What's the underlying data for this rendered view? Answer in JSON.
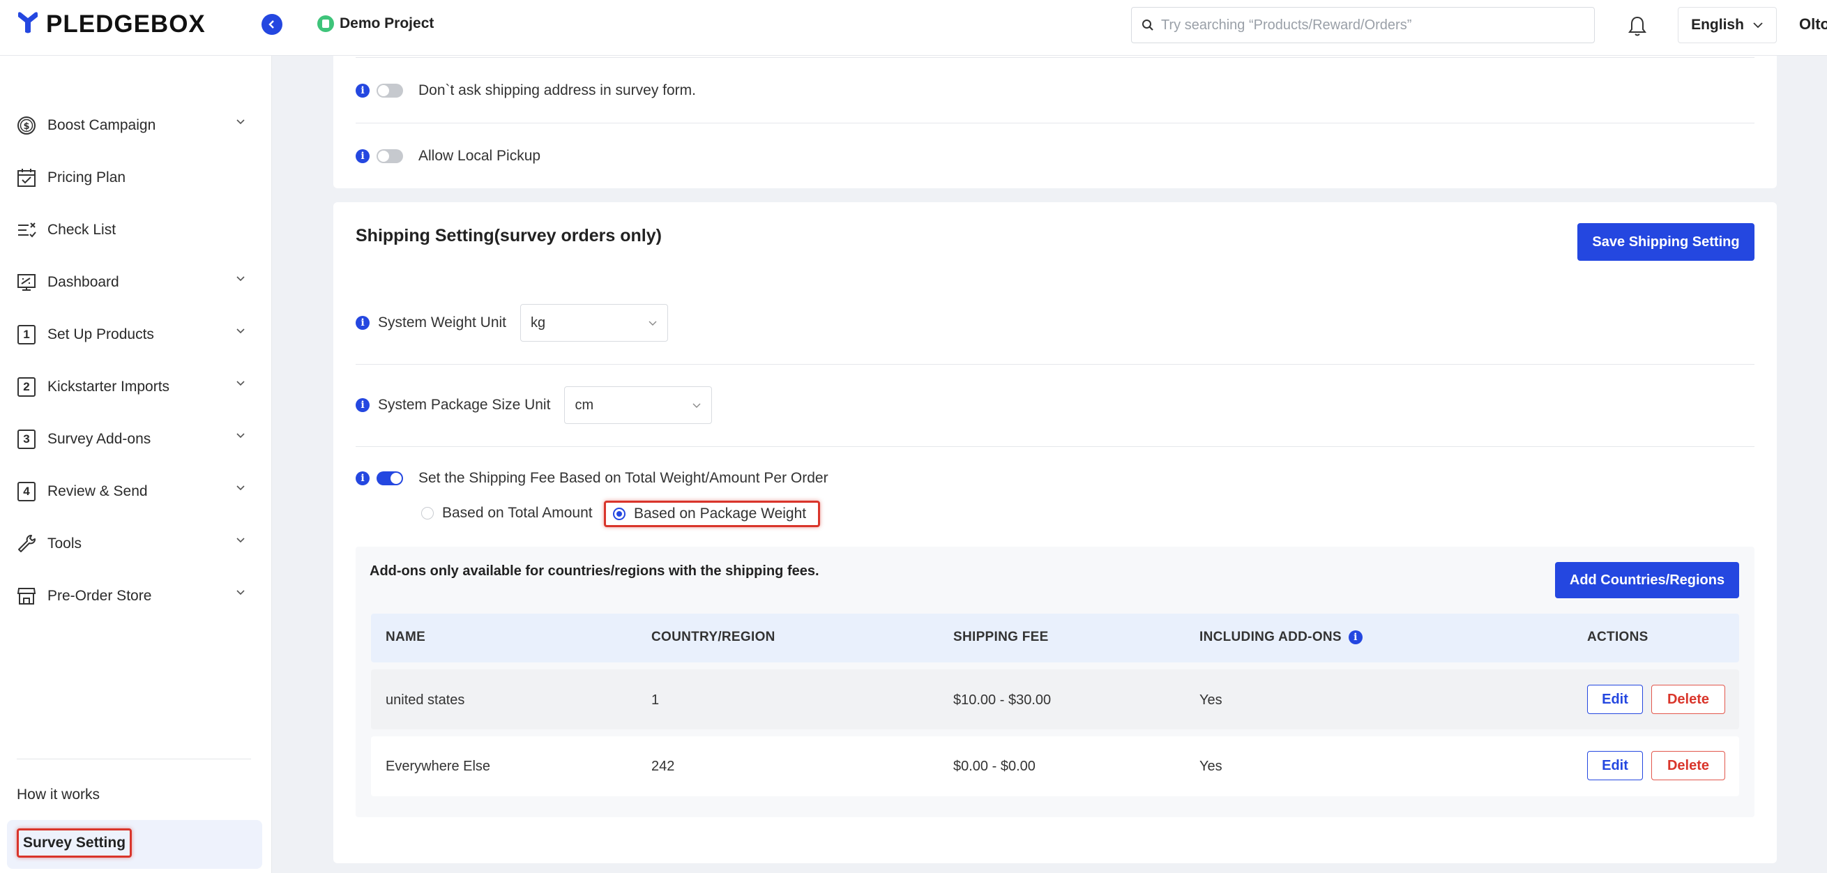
{
  "header": {
    "logo_text": "PLEDGEBOX",
    "project_name": "Demo Project",
    "search_placeholder": "Try searching “Products/Reward/Orders”",
    "language": "English",
    "user_name": "Olto"
  },
  "sidebar": {
    "items": [
      {
        "label": "Boost Campaign",
        "icon": "dollar-circle-icon",
        "expandable": true
      },
      {
        "label": "Pricing Plan",
        "icon": "calendar-check-icon",
        "expandable": false
      },
      {
        "label": "Check List",
        "icon": "checklist-icon",
        "expandable": false
      },
      {
        "label": "Dashboard",
        "icon": "dashboard-chart-icon",
        "expandable": true
      },
      {
        "label": "Set Up Products",
        "icon": "step-1-icon",
        "step": "1",
        "expandable": true
      },
      {
        "label": "Kickstarter Imports",
        "icon": "step-2-icon",
        "step": "2",
        "expandable": true
      },
      {
        "label": "Survey Add-ons",
        "icon": "step-3-icon",
        "step": "3",
        "expandable": true
      },
      {
        "label": "Review & Send",
        "icon": "step-4-icon",
        "step": "4",
        "expandable": true
      },
      {
        "label": "Tools",
        "icon": "wrench-icon",
        "expandable": true
      },
      {
        "label": "Pre-Order Store",
        "icon": "store-icon",
        "expandable": true
      }
    ],
    "how_it_works": "How it works",
    "survey_setting": "Survey Setting"
  },
  "address_settings": {
    "dont_ask_shipping": {
      "label": "Don`t ask shipping address in survey form.",
      "enabled": false
    },
    "allow_local_pickup": {
      "label": "Allow Local Pickup",
      "enabled": false
    }
  },
  "shipping": {
    "title": "Shipping Setting(survey orders only)",
    "save_button": "Save Shipping Setting",
    "weight_unit_label": "System Weight Unit",
    "weight_unit_value": "kg",
    "package_unit_label": "System Package Size Unit",
    "package_unit_value": "cm",
    "fee_toggle_label": "Set the Shipping Fee Based on Total Weight/Amount Per Order",
    "fee_toggle_enabled": true,
    "radio_total_amount": "Based on Total Amount",
    "radio_package_weight": "Based on Package Weight",
    "selected_basis": "Based on Package Weight",
    "addons_note": "Add-ons only available for countries/regions with the shipping fees.",
    "add_countries_button": "Add Countries/Regions",
    "table": {
      "headers": [
        "NAME",
        "COUNTRY/REGION",
        "SHIPPING FEE",
        "INCLUDING ADD-ONS",
        "ACTIONS"
      ],
      "rows": [
        {
          "name": "united states",
          "country_region": "1",
          "shipping_fee": "$10.00 - $30.00",
          "including_addons": "Yes"
        },
        {
          "name": "Everywhere Else",
          "country_region": "242",
          "shipping_fee": "$0.00 - $0.00",
          "including_addons": "Yes"
        }
      ],
      "edit_label": "Edit",
      "delete_label": "Delete"
    }
  },
  "colors": {
    "accent": "#2447e0",
    "danger": "#d9352b",
    "project_dot": "#3ec47a"
  }
}
